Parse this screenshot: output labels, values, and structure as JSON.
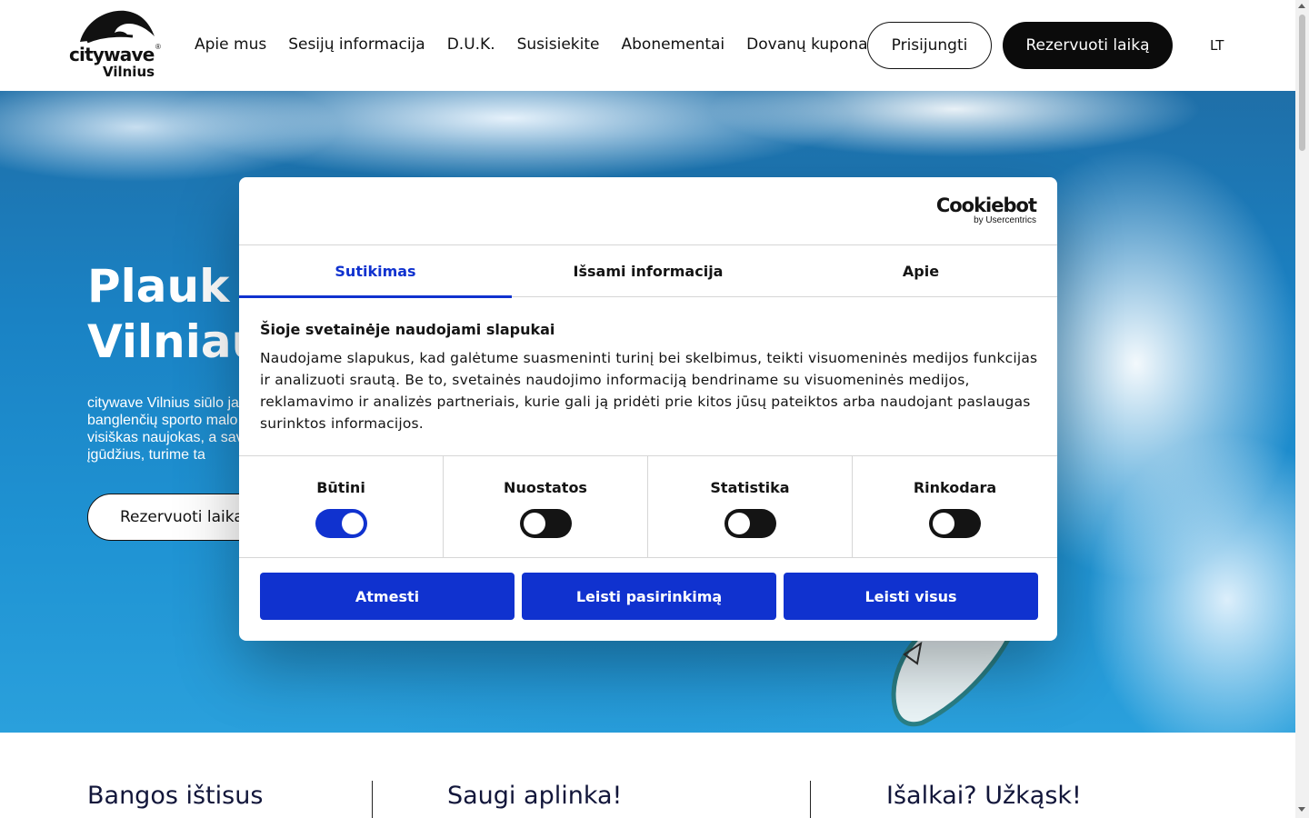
{
  "header": {
    "logo": {
      "brand": "citywave",
      "city": "Vilnius",
      "reg_mark": "®"
    },
    "nav": [
      "Apie mus",
      "Sesijų informacija",
      "D.U.K.",
      "Susisiekite",
      "Abonementai",
      "Dovanų kuponai"
    ],
    "login_label": "Prisijungti",
    "reserve_label": "Rezervuoti laiką",
    "language": "LT"
  },
  "hero": {
    "title_line1": "Plauk b",
    "title_line2": "Vilniaus",
    "text": "citywave Vilnius siūlo ja banglenčių sporto malo esi visiškas naujokas, a savo įgūdžius, turime ta",
    "button_label": "Rezervuoti laika"
  },
  "features": [
    "Bangos ištisus",
    "Saugi aplinka!",
    "Išalkai? Užkąsk!"
  ],
  "cookie_dialog": {
    "provider_name": "Cookiebot",
    "provider_sub": "by Usercentrics",
    "tabs": [
      {
        "label": "Sutikimas",
        "active": true
      },
      {
        "label": "Išsami informacija",
        "active": false
      },
      {
        "label": "Apie",
        "active": false
      }
    ],
    "heading": "Šioje svetainėje naudojami slapukai",
    "body": "Naudojame slapukus, kad galėtume suasmeninti turinį bei skelbimus, teikti visuomeninės medijos funkcijas ir analizuoti srautą. Be to, svetainės naudojimo informaciją bendriname su visuomeninės medijos, reklamavimo ir analizės partneriais, kurie gali ją pridėti prie kitos jūsų pateiktos arba naudojant paslaugas surinktos informacijos.",
    "categories": [
      {
        "label": "Būtini",
        "enabled": true
      },
      {
        "label": "Nuostatos",
        "enabled": false
      },
      {
        "label": "Statistika",
        "enabled": false
      },
      {
        "label": "Rinkodara",
        "enabled": false
      }
    ],
    "buttons": {
      "reject": "Atmesti",
      "allow_selection": "Leisti pasirinkimą",
      "allow_all": "Leisti visus"
    }
  },
  "colors": {
    "accent": "#1032cf",
    "dark": "#0b0b0b",
    "heading": "#12163a"
  }
}
